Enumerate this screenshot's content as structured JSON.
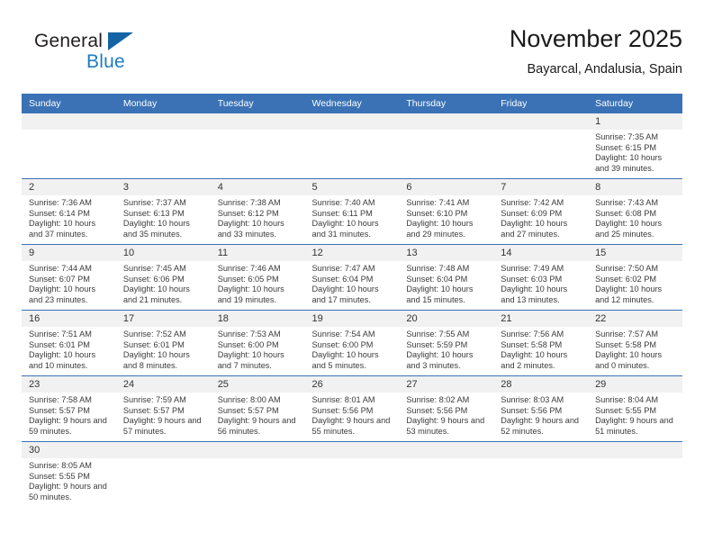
{
  "brand": {
    "name_dark": "General",
    "name_blue": "Blue",
    "accent_color": "#1f7cc1",
    "triangle_color": "#1464a5"
  },
  "header": {
    "title": "November 2025",
    "subtitle": "Bayarcal, Andalusia, Spain"
  },
  "theme": {
    "header_bar_color": "#3a72b5",
    "daynum_band_color": "#f1f1f1",
    "text_color": "#3b3b3b"
  },
  "weekday_headers": [
    "Sunday",
    "Monday",
    "Tuesday",
    "Wednesday",
    "Thursday",
    "Friday",
    "Saturday"
  ],
  "weeks": [
    [
      {
        "day": "",
        "blank": true
      },
      {
        "day": "",
        "blank": true
      },
      {
        "day": "",
        "blank": true
      },
      {
        "day": "",
        "blank": true
      },
      {
        "day": "",
        "blank": true
      },
      {
        "day": "",
        "blank": true
      },
      {
        "day": "1",
        "sunrise": "Sunrise: 7:35 AM",
        "sunset": "Sunset: 6:15 PM",
        "daylight": "Daylight: 10 hours and 39 minutes."
      }
    ],
    [
      {
        "day": "2",
        "sunrise": "Sunrise: 7:36 AM",
        "sunset": "Sunset: 6:14 PM",
        "daylight": "Daylight: 10 hours and 37 minutes."
      },
      {
        "day": "3",
        "sunrise": "Sunrise: 7:37 AM",
        "sunset": "Sunset: 6:13 PM",
        "daylight": "Daylight: 10 hours and 35 minutes."
      },
      {
        "day": "4",
        "sunrise": "Sunrise: 7:38 AM",
        "sunset": "Sunset: 6:12 PM",
        "daylight": "Daylight: 10 hours and 33 minutes."
      },
      {
        "day": "5",
        "sunrise": "Sunrise: 7:40 AM",
        "sunset": "Sunset: 6:11 PM",
        "daylight": "Daylight: 10 hours and 31 minutes."
      },
      {
        "day": "6",
        "sunrise": "Sunrise: 7:41 AM",
        "sunset": "Sunset: 6:10 PM",
        "daylight": "Daylight: 10 hours and 29 minutes."
      },
      {
        "day": "7",
        "sunrise": "Sunrise: 7:42 AM",
        "sunset": "Sunset: 6:09 PM",
        "daylight": "Daylight: 10 hours and 27 minutes."
      },
      {
        "day": "8",
        "sunrise": "Sunrise: 7:43 AM",
        "sunset": "Sunset: 6:08 PM",
        "daylight": "Daylight: 10 hours and 25 minutes."
      }
    ],
    [
      {
        "day": "9",
        "sunrise": "Sunrise: 7:44 AM",
        "sunset": "Sunset: 6:07 PM",
        "daylight": "Daylight: 10 hours and 23 minutes."
      },
      {
        "day": "10",
        "sunrise": "Sunrise: 7:45 AM",
        "sunset": "Sunset: 6:06 PM",
        "daylight": "Daylight: 10 hours and 21 minutes."
      },
      {
        "day": "11",
        "sunrise": "Sunrise: 7:46 AM",
        "sunset": "Sunset: 6:05 PM",
        "daylight": "Daylight: 10 hours and 19 minutes."
      },
      {
        "day": "12",
        "sunrise": "Sunrise: 7:47 AM",
        "sunset": "Sunset: 6:04 PM",
        "daylight": "Daylight: 10 hours and 17 minutes."
      },
      {
        "day": "13",
        "sunrise": "Sunrise: 7:48 AM",
        "sunset": "Sunset: 6:04 PM",
        "daylight": "Daylight: 10 hours and 15 minutes."
      },
      {
        "day": "14",
        "sunrise": "Sunrise: 7:49 AM",
        "sunset": "Sunset: 6:03 PM",
        "daylight": "Daylight: 10 hours and 13 minutes."
      },
      {
        "day": "15",
        "sunrise": "Sunrise: 7:50 AM",
        "sunset": "Sunset: 6:02 PM",
        "daylight": "Daylight: 10 hours and 12 minutes."
      }
    ],
    [
      {
        "day": "16",
        "sunrise": "Sunrise: 7:51 AM",
        "sunset": "Sunset: 6:01 PM",
        "daylight": "Daylight: 10 hours and 10 minutes."
      },
      {
        "day": "17",
        "sunrise": "Sunrise: 7:52 AM",
        "sunset": "Sunset: 6:01 PM",
        "daylight": "Daylight: 10 hours and 8 minutes."
      },
      {
        "day": "18",
        "sunrise": "Sunrise: 7:53 AM",
        "sunset": "Sunset: 6:00 PM",
        "daylight": "Daylight: 10 hours and 7 minutes."
      },
      {
        "day": "19",
        "sunrise": "Sunrise: 7:54 AM",
        "sunset": "Sunset: 6:00 PM",
        "daylight": "Daylight: 10 hours and 5 minutes."
      },
      {
        "day": "20",
        "sunrise": "Sunrise: 7:55 AM",
        "sunset": "Sunset: 5:59 PM",
        "daylight": "Daylight: 10 hours and 3 minutes."
      },
      {
        "day": "21",
        "sunrise": "Sunrise: 7:56 AM",
        "sunset": "Sunset: 5:58 PM",
        "daylight": "Daylight: 10 hours and 2 minutes."
      },
      {
        "day": "22",
        "sunrise": "Sunrise: 7:57 AM",
        "sunset": "Sunset: 5:58 PM",
        "daylight": "Daylight: 10 hours and 0 minutes."
      }
    ],
    [
      {
        "day": "23",
        "sunrise": "Sunrise: 7:58 AM",
        "sunset": "Sunset: 5:57 PM",
        "daylight": "Daylight: 9 hours and 59 minutes."
      },
      {
        "day": "24",
        "sunrise": "Sunrise: 7:59 AM",
        "sunset": "Sunset: 5:57 PM",
        "daylight": "Daylight: 9 hours and 57 minutes."
      },
      {
        "day": "25",
        "sunrise": "Sunrise: 8:00 AM",
        "sunset": "Sunset: 5:57 PM",
        "daylight": "Daylight: 9 hours and 56 minutes."
      },
      {
        "day": "26",
        "sunrise": "Sunrise: 8:01 AM",
        "sunset": "Sunset: 5:56 PM",
        "daylight": "Daylight: 9 hours and 55 minutes."
      },
      {
        "day": "27",
        "sunrise": "Sunrise: 8:02 AM",
        "sunset": "Sunset: 5:56 PM",
        "daylight": "Daylight: 9 hours and 53 minutes."
      },
      {
        "day": "28",
        "sunrise": "Sunrise: 8:03 AM",
        "sunset": "Sunset: 5:56 PM",
        "daylight": "Daylight: 9 hours and 52 minutes."
      },
      {
        "day": "29",
        "sunrise": "Sunrise: 8:04 AM",
        "sunset": "Sunset: 5:55 PM",
        "daylight": "Daylight: 9 hours and 51 minutes."
      }
    ],
    [
      {
        "day": "30",
        "sunrise": "Sunrise: 8:05 AM",
        "sunset": "Sunset: 5:55 PM",
        "daylight": "Daylight: 9 hours and 50 minutes."
      },
      {
        "day": "",
        "blank": true
      },
      {
        "day": "",
        "blank": true
      },
      {
        "day": "",
        "blank": true
      },
      {
        "day": "",
        "blank": true
      },
      {
        "day": "",
        "blank": true
      },
      {
        "day": "",
        "blank": true
      }
    ]
  ]
}
